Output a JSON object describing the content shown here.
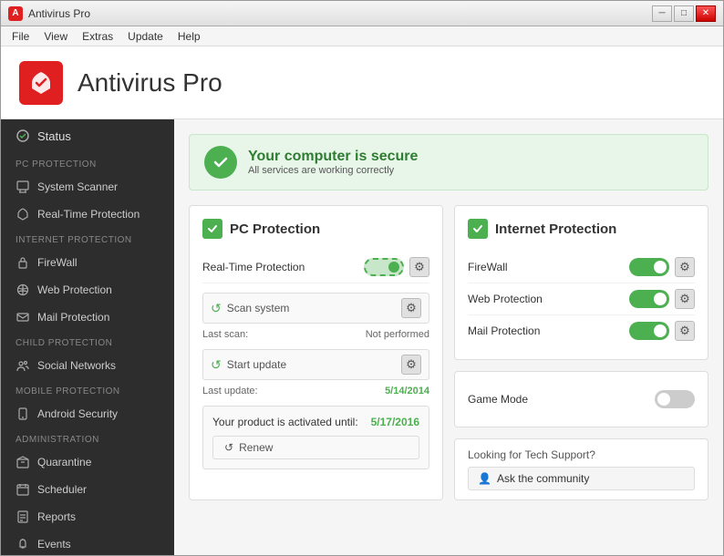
{
  "window": {
    "title": "Antivirus Pro",
    "buttons": {
      "minimize": "─",
      "maximize": "□",
      "close": "✕"
    }
  },
  "menu": {
    "items": [
      "File",
      "View",
      "Extras",
      "Update",
      "Help"
    ]
  },
  "header": {
    "app_title": "Antivirus Pro"
  },
  "sidebar": {
    "status_label": "Status",
    "sections": [
      {
        "label": "PC PROTECTION",
        "items": [
          {
            "id": "system-scanner",
            "label": "System Scanner",
            "icon": "monitor"
          },
          {
            "id": "realtime-protection",
            "label": "Real-Time Protection",
            "icon": "shield"
          }
        ]
      },
      {
        "label": "INTERNET PROTECTION",
        "items": [
          {
            "id": "firewall",
            "label": "FireWall",
            "icon": "lock"
          },
          {
            "id": "web-protection",
            "label": "Web Protection",
            "icon": "globe"
          },
          {
            "id": "mail-protection",
            "label": "Mail Protection",
            "icon": "mail"
          }
        ]
      },
      {
        "label": "CHILD PROTECTION",
        "items": [
          {
            "id": "social-networks",
            "label": "Social Networks",
            "icon": "people"
          }
        ]
      },
      {
        "label": "MOBILE PROTECTION",
        "items": [
          {
            "id": "android-security",
            "label": "Android Security",
            "icon": "phone"
          }
        ]
      },
      {
        "label": "ADMINISTRATION",
        "items": [
          {
            "id": "quarantine",
            "label": "Quarantine",
            "icon": "box"
          },
          {
            "id": "scheduler",
            "label": "Scheduler",
            "icon": "calendar"
          },
          {
            "id": "reports",
            "label": "Reports",
            "icon": "report"
          },
          {
            "id": "events",
            "label": "Events",
            "icon": "bell"
          }
        ]
      }
    ]
  },
  "status_banner": {
    "title": "Your computer is secure",
    "subtitle": "All services are working correctly"
  },
  "pc_protection": {
    "title": "PC Protection",
    "realtime_label": "Real-Time Protection",
    "scan_label": "Scan system",
    "last_scan_label": "Last scan:",
    "last_scan_value": "Not performed",
    "update_label": "Start update",
    "last_update_label": "Last update:",
    "last_update_value": "5/14/2014",
    "activation_label": "Your product is activated until:",
    "activation_date": "5/17/2016",
    "renew_label": "Renew"
  },
  "internet_protection": {
    "title": "Internet Protection",
    "firewall_label": "FireWall",
    "web_label": "Web Protection",
    "mail_label": "Mail Protection",
    "game_mode_label": "Game Mode"
  },
  "tech_support": {
    "title": "Looking for Tech Support?",
    "community_label": "Ask the community"
  },
  "colors": {
    "green": "#4caf50",
    "sidebar_bg": "#2d2d2d",
    "accent_red": "#e02020"
  }
}
